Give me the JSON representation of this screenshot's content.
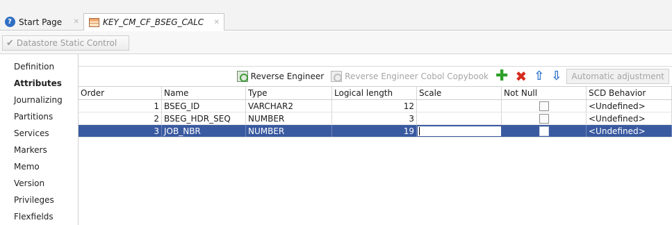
{
  "tabs": [
    {
      "label": "Start Page",
      "icon": "help-icon"
    },
    {
      "label": "KEY_CM_CF_BSEG_CALC",
      "icon": "datastore-table-icon"
    }
  ],
  "toolbar": {
    "datastore_control_label": "Datastore Static Control"
  },
  "nav": {
    "items": [
      "Definition",
      "Attributes",
      "Journalizing",
      "Partitions",
      "Services",
      "Markers",
      "Memo",
      "Version",
      "Privileges",
      "Flexfields"
    ],
    "active": "Attributes"
  },
  "actions": {
    "reverse_engineer": "Reverse Engineer",
    "reverse_engineer_cobol": "Reverse Engineer Cobol Copybook",
    "automatic_adjustment": "Automatic adjustment"
  },
  "table": {
    "columns": [
      "Order",
      "Name",
      "Type",
      "Logical length",
      "Scale",
      "Not Null",
      "SCD Behavior"
    ],
    "rows": [
      {
        "order": "1",
        "name": "BSEG_ID",
        "type": "VARCHAR2",
        "length": "12",
        "scale": "",
        "not_null": false,
        "scd": "<Undefined>"
      },
      {
        "order": "2",
        "name": "BSEG_HDR_SEQ",
        "type": "NUMBER",
        "length": "3",
        "scale": "",
        "not_null": false,
        "scd": "<Undefined>"
      },
      {
        "order": "3",
        "name": "JOB_NBR",
        "type": "NUMBER",
        "length": "19",
        "scale": "",
        "not_null": false,
        "scd": "<Undefined>",
        "selected": true
      }
    ]
  },
  "colors": {
    "selection": "#3a5aa0",
    "add": "#2ea02b",
    "delete": "#d62b1f",
    "arrows": "#2e73c9"
  }
}
